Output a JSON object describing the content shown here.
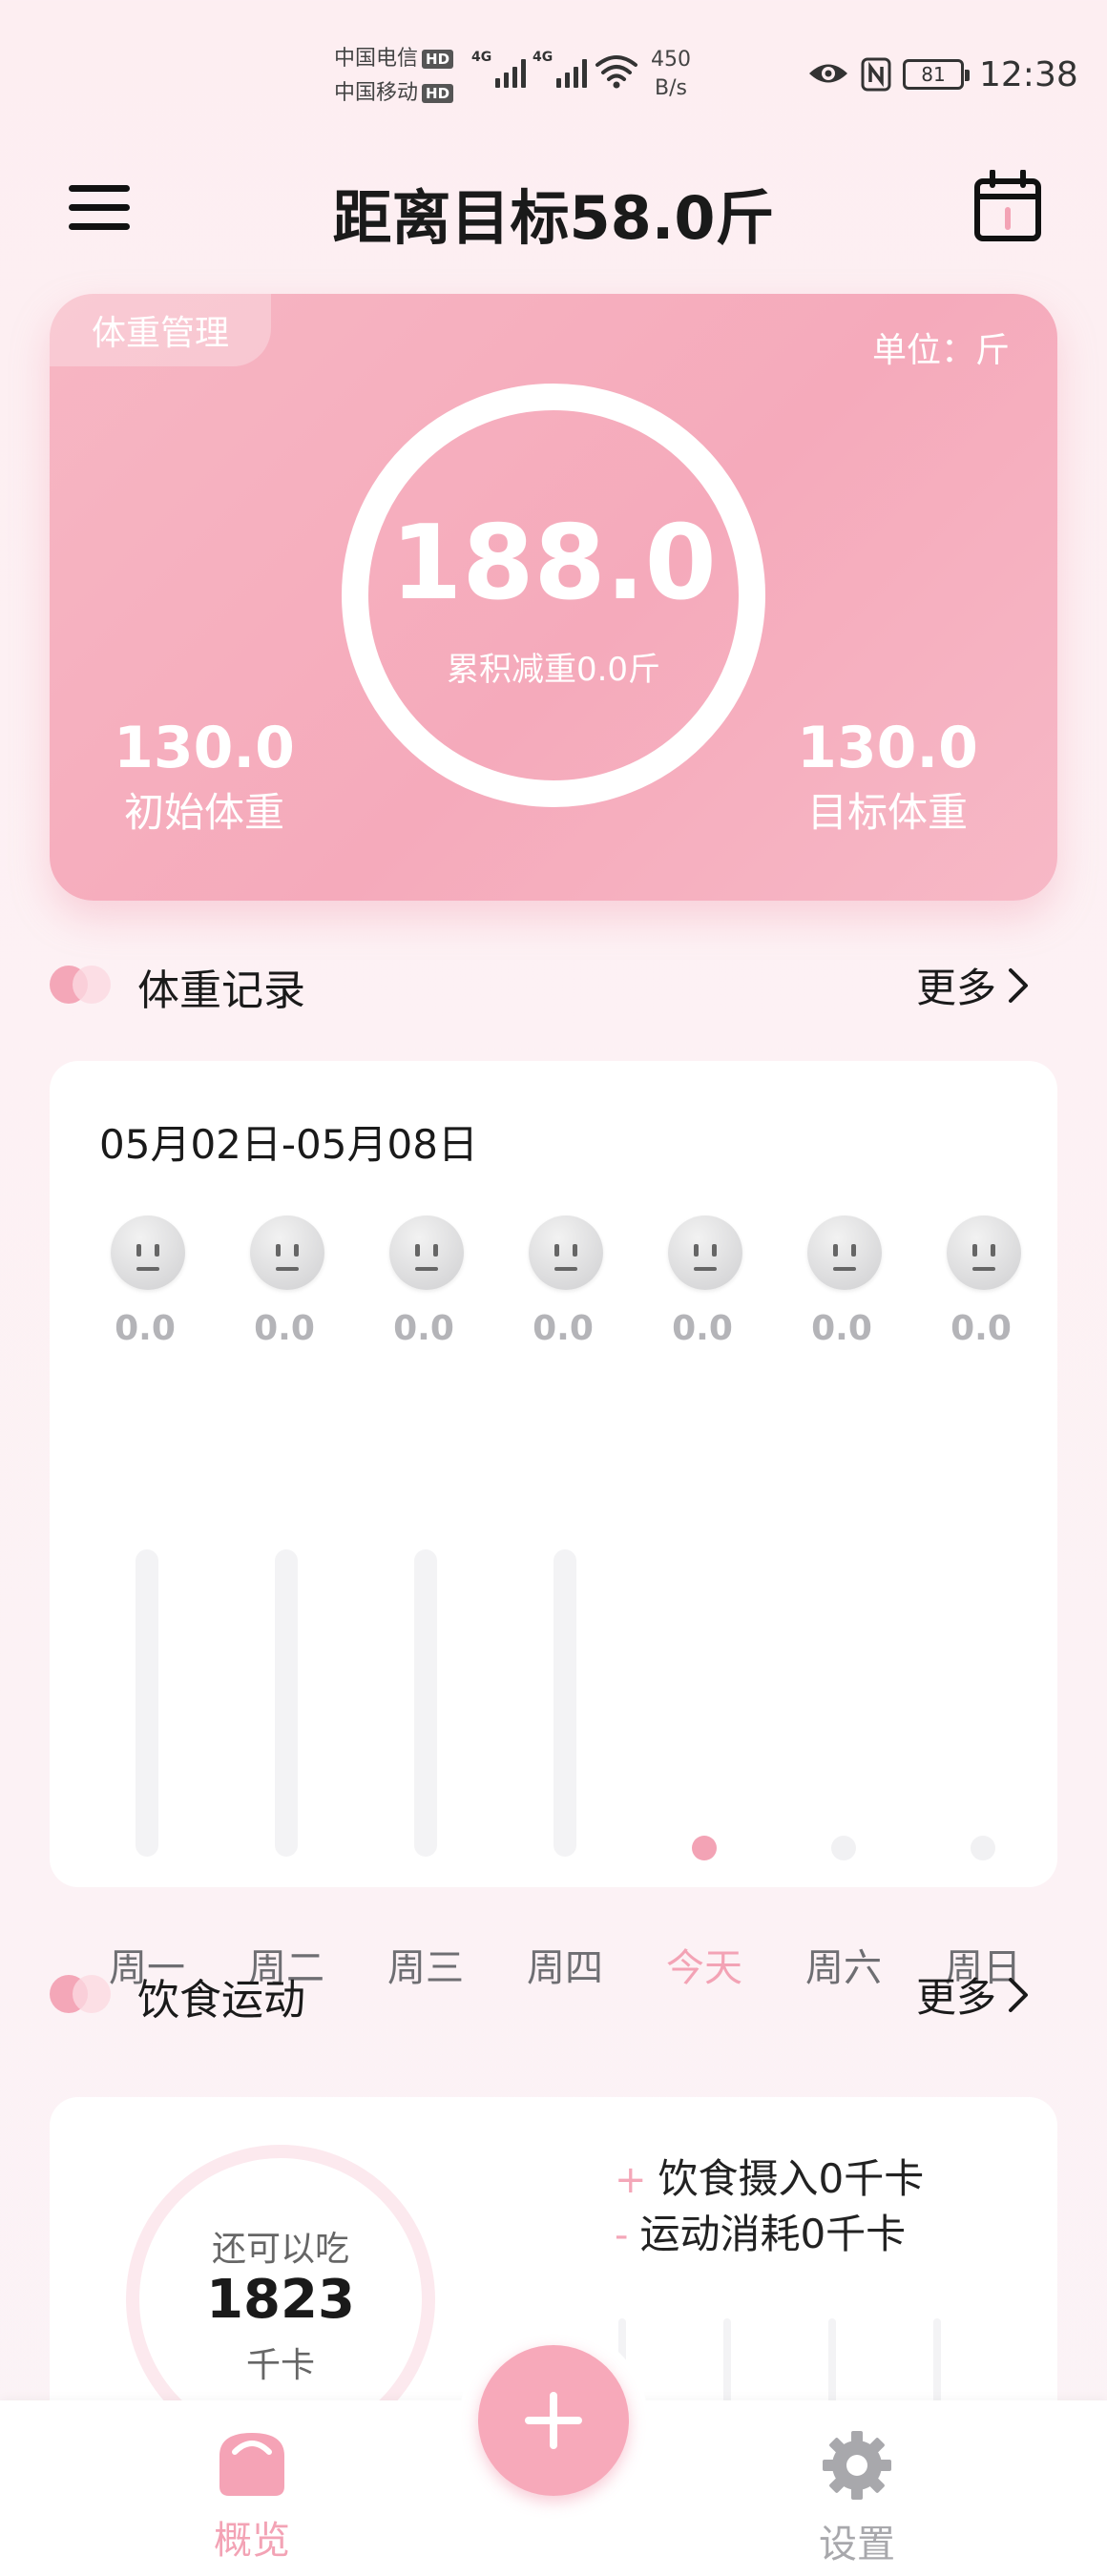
{
  "status_bar": {
    "carrier_1": "中国电信",
    "carrier_2": "中国移动",
    "hd_badge": "HD",
    "network_type": "4G",
    "speed_value": "450",
    "speed_unit": "B/s",
    "battery_level": "81",
    "time": "12:38"
  },
  "header": {
    "title": "距离目标58.0斤",
    "menu_icon": "hamburger-menu-icon",
    "calendar_icon": "calendar-icon"
  },
  "weight_summary": {
    "tag": "体重管理",
    "unit": "单位：斤",
    "current_weight": "188.0",
    "lost_text": "累积减重0.0斤",
    "initial_value": "130.0",
    "initial_label": "初始体重",
    "target_value": "130.0",
    "target_label": "目标体重"
  },
  "weight_record": {
    "title": "体重记录",
    "more_label": "更多",
    "week_range": "05月02日-05月08日",
    "days": [
      {
        "label": "周一",
        "value": "0.0",
        "state": "past"
      },
      {
        "label": "周二",
        "value": "0.0",
        "state": "past"
      },
      {
        "label": "周三",
        "value": "0.0",
        "state": "past"
      },
      {
        "label": "周四",
        "value": "0.0",
        "state": "past"
      },
      {
        "label": "今天",
        "value": "0.0",
        "state": "today"
      },
      {
        "label": "周六",
        "value": "0.0",
        "state": "future"
      },
      {
        "label": "周日",
        "value": "0.0",
        "state": "future"
      }
    ]
  },
  "diet_exercise": {
    "title": "饮食运动",
    "more_label": "更多",
    "remaining_label": "还可以吃",
    "remaining_kcal": "1823",
    "remaining_unit": "千卡",
    "intake_sign": "+",
    "intake_text": "饮食摄入0千卡",
    "burn_sign": "-",
    "burn_text": "运动消耗0千卡"
  },
  "bottom_nav": {
    "overview_label": "概览",
    "settings_label": "设置",
    "overview_icon": "scale-icon",
    "add_icon": "plus-icon",
    "settings_icon": "gear-icon"
  },
  "colors": {
    "accent": "#f5aabb",
    "accent_text": "#f3a3b5",
    "muted_text": "#6e6e72",
    "inactive_nav": "#a8a8ac"
  }
}
